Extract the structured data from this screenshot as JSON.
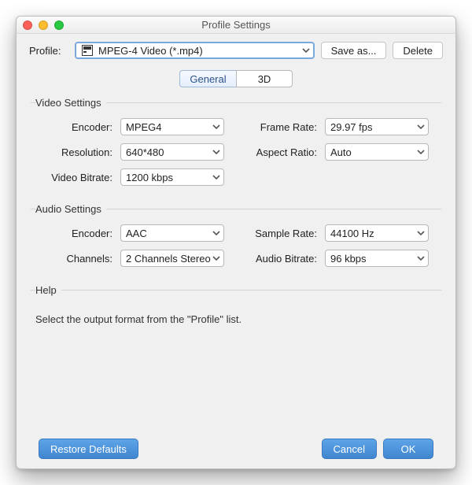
{
  "title": "Profile Settings",
  "profileRow": {
    "label": "Profile:",
    "value": "MPEG-4 Video (*.mp4)",
    "saveAs": "Save as...",
    "delete": "Delete"
  },
  "tabs": {
    "general": "General",
    "threeD": "3D",
    "selected": "general"
  },
  "videoGroup": {
    "legend": "Video Settings",
    "encoderLabel": "Encoder:",
    "encoder": "MPEG4",
    "resolutionLabel": "Resolution:",
    "resolution": "640*480",
    "bitrateLabel": "Video Bitrate:",
    "bitrate": "1200 kbps",
    "frameRateLabel": "Frame Rate:",
    "frameRate": "29.97 fps",
    "aspectLabel": "Aspect Ratio:",
    "aspect": "Auto"
  },
  "audioGroup": {
    "legend": "Audio Settings",
    "encoderLabel": "Encoder:",
    "encoder": "AAC",
    "channelsLabel": "Channels:",
    "channels": "2 Channels Stereo",
    "sampleLabel": "Sample Rate:",
    "sample": "44100 Hz",
    "bitrateLabel": "Audio Bitrate:",
    "bitrate": "96 kbps"
  },
  "helpGroup": {
    "legend": "Help",
    "text": "Select the output format from the \"Profile\" list."
  },
  "footer": {
    "restore": "Restore Defaults",
    "cancel": "Cancel",
    "ok": "OK"
  }
}
